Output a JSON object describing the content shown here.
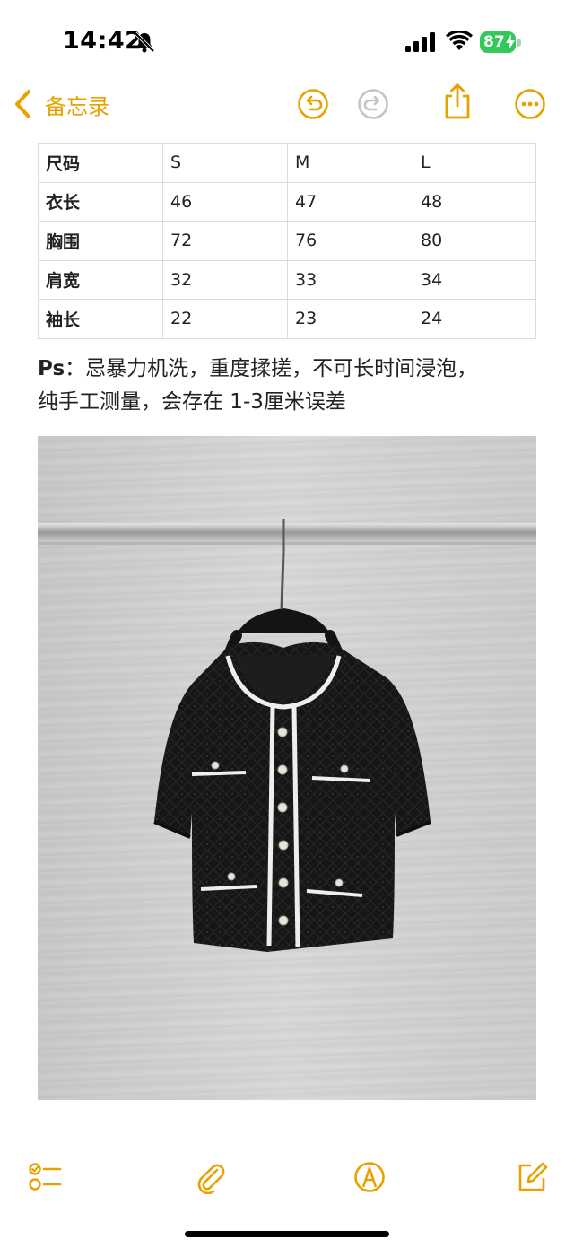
{
  "status_bar": {
    "time": "14:42",
    "battery": "87",
    "icons": [
      "bell-slash-icon",
      "cellular-signal-icon",
      "wifi-icon",
      "battery-charging-icon"
    ]
  },
  "nav": {
    "back_label": "备忘录",
    "accent_color": "#e8a200",
    "buttons": [
      "undo-icon",
      "redo-icon",
      "share-icon",
      "more-icon"
    ]
  },
  "size_table": {
    "header": [
      "尺码",
      "S",
      "M",
      "L"
    ],
    "rows": [
      [
        "衣长",
        "46",
        "47",
        "48"
      ],
      [
        "胸围",
        "72",
        "76",
        "80"
      ],
      [
        "肩宽",
        "32",
        "33",
        "34"
      ],
      [
        "袖长",
        "22",
        "23",
        "24"
      ]
    ]
  },
  "note": {
    "ps_label": "Ps",
    "line1": "：忌暴力机洗，重度揉搓，不可长时间浸泡，",
    "line2": "纯手工测量，会存在 1-3厘米误差"
  },
  "toolbar": {
    "icons": [
      "checklist-icon",
      "paperclip-icon",
      "markup-pen-icon",
      "compose-icon"
    ]
  }
}
